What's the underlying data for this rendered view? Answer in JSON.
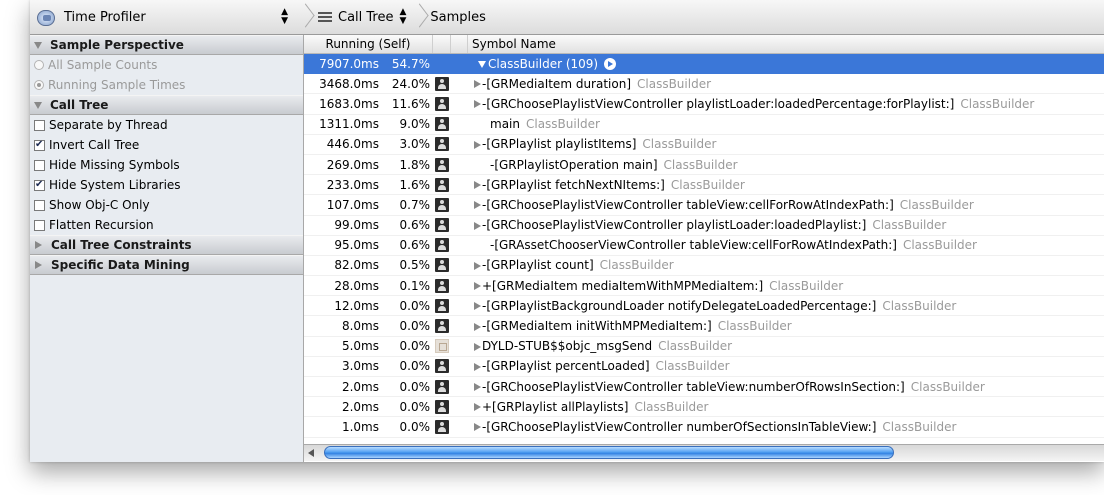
{
  "jumpbar": {
    "instrument": "Time Profiler",
    "view": "Call Tree",
    "detail": "Samples"
  },
  "sidebar": {
    "sections": [
      {
        "title": "Sample Perspective",
        "expanded": true,
        "items": [
          {
            "type": "radio",
            "label": "All Sample Counts",
            "checked": false,
            "disabled": true
          },
          {
            "type": "radio",
            "label": "Running Sample Times",
            "checked": true,
            "disabled": true
          }
        ]
      },
      {
        "title": "Call Tree",
        "expanded": true,
        "items": [
          {
            "type": "checkbox",
            "label": "Separate by Thread",
            "checked": false
          },
          {
            "type": "checkbox",
            "label": "Invert Call Tree",
            "checked": true
          },
          {
            "type": "checkbox",
            "label": "Hide Missing Symbols",
            "checked": false
          },
          {
            "type": "checkbox",
            "label": "Hide System Libraries",
            "checked": true
          },
          {
            "type": "checkbox",
            "label": "Show Obj-C Only",
            "checked": false
          },
          {
            "type": "checkbox",
            "label": "Flatten Recursion",
            "checked": false
          }
        ]
      },
      {
        "title": "Call Tree Constraints",
        "expanded": false,
        "items": []
      },
      {
        "title": "Specific Data Mining",
        "expanded": false,
        "items": []
      }
    ]
  },
  "table": {
    "headers": {
      "running": "Running (Self)",
      "symbol": "Symbol Name"
    },
    "rows": [
      {
        "time": "7907.0ms",
        "pct": "54.7%",
        "icon": "none",
        "disclosure": "open",
        "symbol": "ClassBuilder (109)",
        "library": "",
        "selected": true
      },
      {
        "time": "3468.0ms",
        "pct": "24.0%",
        "icon": "person",
        "disclosure": "closed",
        "symbol": "-[GRMediaItem duration]",
        "library": "ClassBuilder"
      },
      {
        "time": "1683.0ms",
        "pct": "11.6%",
        "icon": "person",
        "disclosure": "closed",
        "symbol": "-[GRChoosePlaylistViewController playlistLoader:loadedPercentage:forPlaylist:]",
        "library": "ClassBuilder"
      },
      {
        "time": "1311.0ms",
        "pct": "9.0%",
        "icon": "person",
        "disclosure": "none",
        "symbol": "main",
        "library": "ClassBuilder"
      },
      {
        "time": "446.0ms",
        "pct": "3.0%",
        "icon": "person",
        "disclosure": "closed",
        "symbol": "-[GRPlaylist playlistItems]",
        "library": "ClassBuilder"
      },
      {
        "time": "269.0ms",
        "pct": "1.8%",
        "icon": "person",
        "disclosure": "none",
        "symbol": "-[GRPlaylistOperation main]",
        "library": "ClassBuilder"
      },
      {
        "time": "233.0ms",
        "pct": "1.6%",
        "icon": "person",
        "disclosure": "closed",
        "symbol": "-[GRPlaylist fetchNextNItems:]",
        "library": "ClassBuilder"
      },
      {
        "time": "107.0ms",
        "pct": "0.7%",
        "icon": "person",
        "disclosure": "closed",
        "symbol": "-[GRChoosePlaylistViewController tableView:cellForRowAtIndexPath:]",
        "library": "ClassBuilder"
      },
      {
        "time": "99.0ms",
        "pct": "0.6%",
        "icon": "person",
        "disclosure": "closed",
        "symbol": "-[GRChoosePlaylistViewController playlistLoader:loadedPlaylist:]",
        "library": "ClassBuilder"
      },
      {
        "time": "95.0ms",
        "pct": "0.6%",
        "icon": "person",
        "disclosure": "none",
        "symbol": "-[GRAssetChooserViewController tableView:cellForRowAtIndexPath:]",
        "library": "ClassBuilder"
      },
      {
        "time": "82.0ms",
        "pct": "0.5%",
        "icon": "person",
        "disclosure": "closed",
        "symbol": "-[GRPlaylist count]",
        "library": "ClassBuilder"
      },
      {
        "time": "28.0ms",
        "pct": "0.1%",
        "icon": "person",
        "disclosure": "closed",
        "symbol": "+[GRMediaItem mediaItemWithMPMediaItem:]",
        "library": "ClassBuilder"
      },
      {
        "time": "12.0ms",
        "pct": "0.0%",
        "icon": "person",
        "disclosure": "closed",
        "symbol": "-[GRPlaylistBackgroundLoader notifyDelegateLoadedPercentage:]",
        "library": "ClassBuilder"
      },
      {
        "time": "8.0ms",
        "pct": "0.0%",
        "icon": "person",
        "disclosure": "closed",
        "symbol": "-[GRMediaItem initWithMPMediaItem:]",
        "library": "ClassBuilder"
      },
      {
        "time": "5.0ms",
        "pct": "0.0%",
        "icon": "library",
        "disclosure": "closed",
        "symbol": "DYLD-STUB$$objc_msgSend",
        "library": "ClassBuilder"
      },
      {
        "time": "3.0ms",
        "pct": "0.0%",
        "icon": "person",
        "disclosure": "closed",
        "symbol": "-[GRPlaylist percentLoaded]",
        "library": "ClassBuilder"
      },
      {
        "time": "2.0ms",
        "pct": "0.0%",
        "icon": "person",
        "disclosure": "closed",
        "symbol": "-[GRChoosePlaylistViewController tableView:numberOfRowsInSection:]",
        "library": "ClassBuilder"
      },
      {
        "time": "2.0ms",
        "pct": "0.0%",
        "icon": "person",
        "disclosure": "closed",
        "symbol": "+[GRPlaylist allPlaylists]",
        "library": "ClassBuilder"
      },
      {
        "time": "1.0ms",
        "pct": "0.0%",
        "icon": "person",
        "disclosure": "closed",
        "symbol": "-[GRChoosePlaylistViewController numberOfSectionsInTableView:]",
        "library": "ClassBuilder"
      }
    ]
  },
  "colors": {
    "selection": "#3b77d8",
    "library_text": "#9a9a9a",
    "sidebar_bg": "#e8ecf1"
  },
  "scrollbar": {
    "position_fraction": 0.0,
    "visible_fraction": 0.75
  }
}
